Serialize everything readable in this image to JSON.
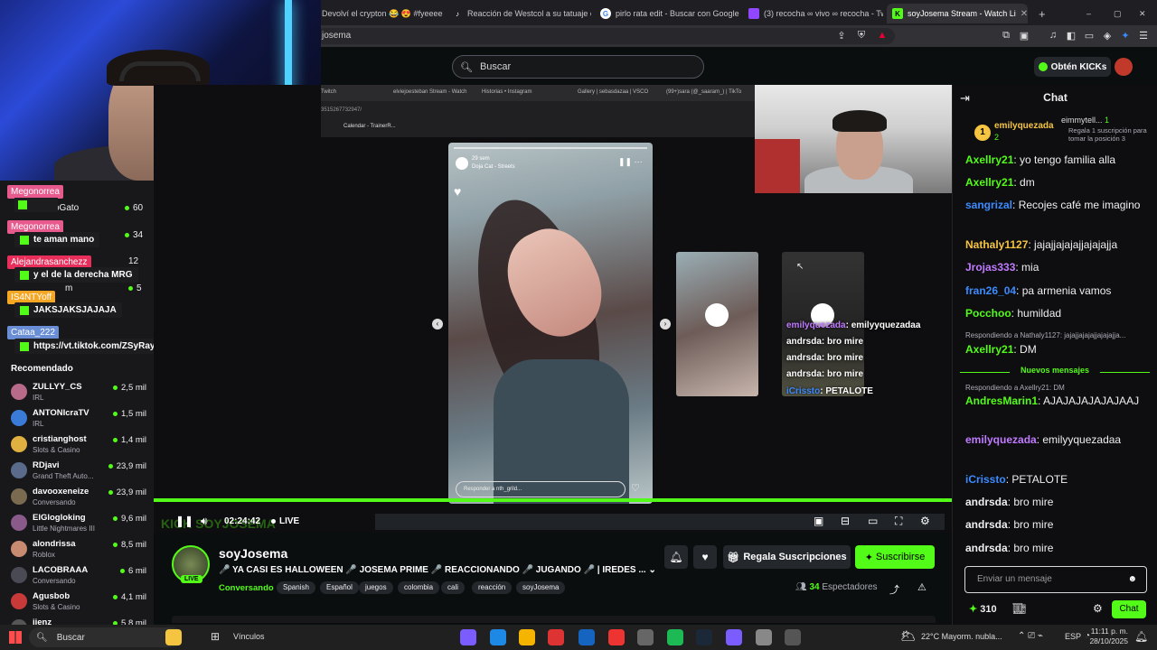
{
  "browser": {
    "tabs": [
      {
        "title": "Devolví el crypton 😂 😍 #fyeeeeee",
        "fav": "tiktok-icon"
      },
      {
        "title": "Reacción de Westcol a su tatuaje en",
        "fav": "tiktok-icon"
      },
      {
        "title": "pirlo rata edit - Buscar con Google",
        "fav": "google-icon"
      },
      {
        "title": "(3) recocha ∞ vivo ∞ recocha - Twitc",
        "fav": "twitch-icon"
      },
      {
        "title": "soyJosema Stream - Watch Li",
        "fav": "kick-icon",
        "active": true
      }
    ],
    "new_tab": "+",
    "url": "josema",
    "window_controls": [
      "–",
      "▢",
      "✕"
    ]
  },
  "kick_header": {
    "search_placeholder": "Buscar",
    "get_kicks": "Obtén KICKs"
  },
  "left_overlay_chat": [
    {
      "name": "Megonorrea",
      "name_color": "#e85a8e",
      "msg": ""
    },
    {
      "name": "Megonorrea",
      "name_color": "#e85a8e",
      "msg": "te aman mano"
    },
    {
      "name": "Alejandrasanchezz",
      "name_color": "#e82f5c",
      "msg": "y el de la derecha MRG"
    },
    {
      "name": "IS4NTYoff",
      "name_color": "#f5a623",
      "msg": "JAKSJAKSJAJAJA"
    },
    {
      "name": "Cataa_222",
      "name_color": "#6a8ed6",
      "msg": "https://vt.tiktok.com/ZSyRay4ym/"
    }
  ],
  "followed": [
    {
      "partial": "oGato",
      "viewers": "60"
    },
    {
      "partial": "",
      "viewers": "34"
    },
    {
      "partial": "",
      "viewers": "12"
    },
    {
      "partial": "m",
      "viewers": "5"
    }
  ],
  "recommended": {
    "title": "Recomendado",
    "items": [
      {
        "name": "ZULLYY_CS",
        "category": "IRL",
        "viewers": "2,5 mil",
        "avatar": "#b86a8a"
      },
      {
        "name": "ANTONIcraTV",
        "category": "IRL",
        "viewers": "1,5 mil",
        "avatar": "#3b7bd8"
      },
      {
        "name": "cristianghost",
        "category": "Slots & Casino",
        "viewers": "1,4 mil",
        "avatar": "#e0b040"
      },
      {
        "name": "RDjavi",
        "category": "Grand Theft Auto...",
        "viewers": "23,9 mil",
        "avatar": "#5a6a8a"
      },
      {
        "name": "davooxeneize",
        "category": "Conversando",
        "viewers": "23,9 mil",
        "avatar": "#7a6a50"
      },
      {
        "name": "ElGlogloking",
        "category": "Little Nightmares III",
        "viewers": "9,6 mil",
        "avatar": "#8a5a8a"
      },
      {
        "name": "alondrissa",
        "category": "Roblox",
        "viewers": "8,5 mil",
        "avatar": "#c88a70"
      },
      {
        "name": "LACOBRAAA",
        "category": "Conversando",
        "viewers": "6 mil",
        "avatar": "#4a4a55"
      },
      {
        "name": "Agusbob",
        "category": "Slots & Casino",
        "viewers": "4,1 mil",
        "avatar": "#c83a3a"
      },
      {
        "name": "jienz",
        "category": "",
        "viewers": "5,8 mil",
        "avatar": "#555"
      }
    ]
  },
  "player": {
    "inner_tabs": [
      "Twitch",
      "elviejoesteban Stream - Watch",
      "Historias • Instagram",
      "Gallery | sebasdazaa | VSCO",
      "(99+)sara (@_saaram_) | TikTo"
    ],
    "inner_url": "3515267732947/",
    "inner_bookmark": "Calendar - TrainerR...",
    "story_user": "29 sem",
    "story_song": "Doja Cat - Streets",
    "story_reply": "Responder a nth_grild...",
    "overlay_chat": [
      {
        "user": "emilyquezada",
        "text": ": emilyyquezadaa"
      },
      {
        "user": "andrsda",
        "text": ": bro mire"
      },
      {
        "user": "andrsda",
        "text": ": bro mire"
      },
      {
        "user": "andrsda",
        "text": ": bro mire"
      },
      {
        "user": "iCrissto",
        "text": ": PETALOTE"
      }
    ],
    "time": "02:24:42",
    "live": "LIVE",
    "watermark": "KICK SOYJOSEMA",
    "progress": 1.0
  },
  "stream": {
    "channel": "soyJosema",
    "live_badge": "LIVE",
    "title": "🎤 YA CASI ES HALLOWEEN 🎤 JOSEMA PRIME 🎤 REACCIONANDO 🎤 JUGANDO 🎤 | IREDES ...",
    "category": "Conversando",
    "tags": [
      "Spanish",
      "Español",
      "juegos",
      "colombia",
      "cali",
      "reacción",
      "soyJosema"
    ],
    "gift_subs": "Regala Suscripciones",
    "subscribe": "Suscribirse",
    "viewers_count": "34",
    "viewers_label": "Espectadores"
  },
  "chat": {
    "title": "Chat",
    "pinned_top": {
      "rank": "1",
      "user": "emilyquezada",
      "count": "2"
    },
    "pinned_second": {
      "user": "eimmytell...",
      "count": "1",
      "text": "Regala 1 suscripción para tomar la posición 3"
    },
    "messages": [
      {
        "user": "Axellry21",
        "color": "#53fc18",
        "text": ": yo tengo familia alla"
      },
      {
        "user": "Axellry21",
        "color": "#53fc18",
        "text": ": dm"
      },
      {
        "user": "sangrizal",
        "color": "#3b8bff",
        "text": ": Recojes café me imagino"
      },
      {
        "user": "Nathaly1127",
        "color": "#f5c542",
        "text": ": jajajjajajajjajajajja"
      },
      {
        "user": "Jrojas333",
        "color": "#c07bff",
        "text": ": mia"
      },
      {
        "user": "fran26_04",
        "color": "#3b8bff",
        "text": ": pa armenia vamos"
      },
      {
        "user": "Pocchoo",
        "color": "#53fc18",
        "text": ": humildad"
      }
    ],
    "reply1": "Respondiendo a Nathaly1127: jajajjajajajjajajajja...",
    "reply1_msg": {
      "user": "Axellry21",
      "color": "#53fc18",
      "text": ": DM"
    },
    "new_messages": "Nuevos mensajes",
    "reply2": "Respondiendo a Axellry21: DM",
    "after": [
      {
        "user": "AndresMarin1",
        "color": "#53fc18",
        "text": ": AJAJAJAJAJAJAAJ"
      },
      {
        "user": "emilyquezada",
        "color": "#c07bff",
        "text": ": emilyyquezadaa"
      },
      {
        "user": "iCrissto",
        "color": "#3b8bff",
        "text": ": PETALOTE"
      },
      {
        "user": "andrsda",
        "color": "#efeff1",
        "text": ": bro mire"
      },
      {
        "user": "andrsda",
        "color": "#efeff1",
        "text": ": bro mire"
      },
      {
        "user": "andrsda",
        "color": "#efeff1",
        "text": ": bro mire"
      }
    ],
    "input_placeholder": "Enviar un mensaje",
    "points": "310",
    "send": "Chat"
  },
  "taskbar": {
    "search": "Buscar",
    "links": "Vínculos",
    "weather": "22°C  Mayorm. nubla...",
    "lang": "ESP",
    "time": "11:11 p. m.",
    "date": "28/10/2025"
  }
}
